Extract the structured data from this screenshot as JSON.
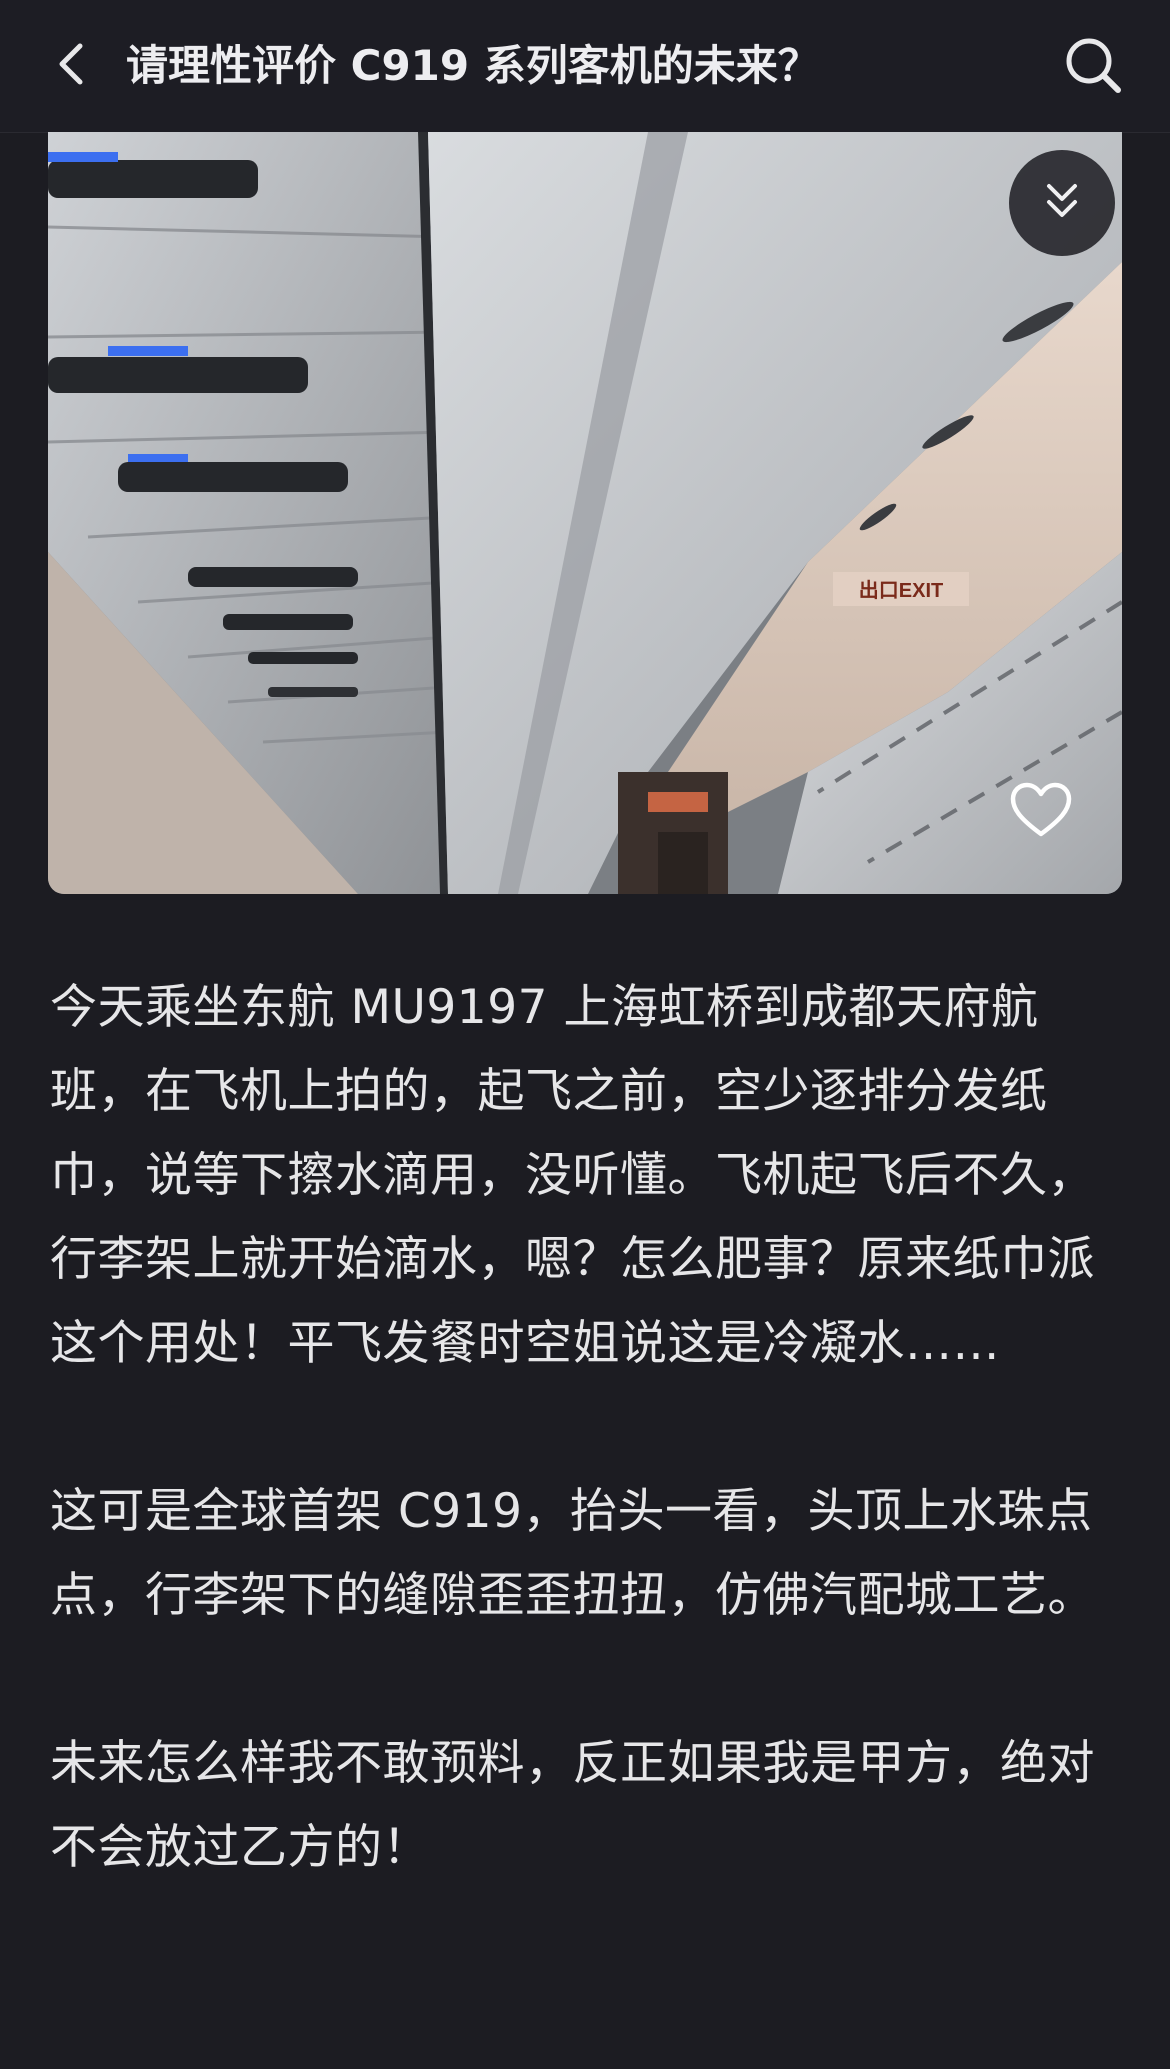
{
  "header": {
    "title": "请理性评价 C919 系列客机的未来？",
    "back_icon": "chevron-left-icon",
    "search_icon": "search-icon"
  },
  "photo": {
    "exit_sign": "出口EXIT",
    "collapse_icon": "double-chevron-down-icon",
    "like_icon": "heart-icon"
  },
  "post": {
    "paragraphs": [
      "今天乘坐东航 MU9197 上海虹桥到成都天府航班，在飞机上拍的，起飞之前，空少逐排分发纸巾，说等下擦水滴用，没听懂。飞机起飞后不久，行李架上就开始滴水，嗯？怎么肥事？原来纸巾派这个用处！平飞发餐时空姐说这是冷凝水……",
      "这可是全球首架 C919，抬头一看，头顶上水珠点点，行李架下的缝隙歪歪扭扭，仿佛汽配城工艺。",
      "未来怎么样我不敢预料，反正如果我是甲方，绝对不会放过乙方的！"
    ]
  }
}
